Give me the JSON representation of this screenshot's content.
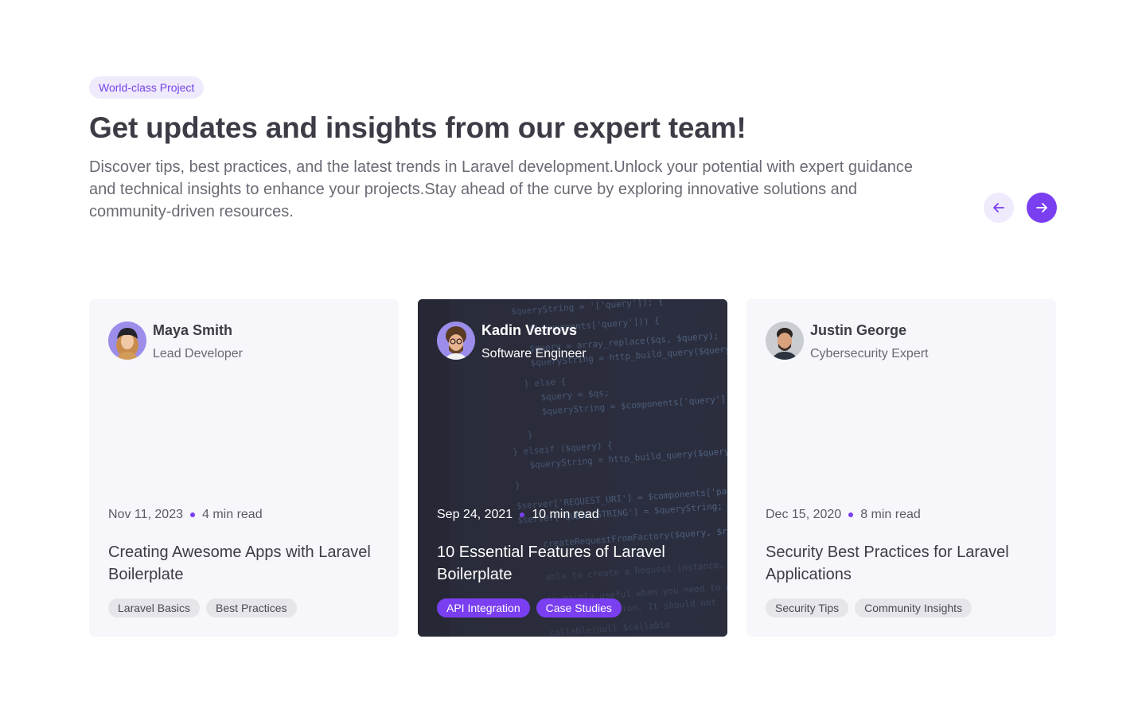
{
  "header": {
    "badge": "World-class Project",
    "title": "Get updates and insights from our expert team!",
    "description": "Discover tips, best practices, and the latest trends in Laravel development.Unlock your potential with expert guidance and technical insights to enhance your projects.Stay ahead of the curve by exploring innovative solutions and community-driven resources."
  },
  "navigation": {
    "prev_icon": "arrow-left-icon",
    "next_icon": "arrow-right-icon"
  },
  "colors": {
    "accent": "#7a3ff0",
    "badge_bg": "#efeafc",
    "card_bg": "#f6f6fb",
    "active_card_bg": "#2b2c3a"
  },
  "cards": [
    {
      "author_name": "Maya Smith",
      "author_role": "Lead Developer",
      "date": "Nov 11, 2023",
      "read_time": "4 min read",
      "title": "Creating Awesome Apps with Laravel Boilerplate",
      "tags": [
        "Laravel Basics",
        "Best Practices"
      ]
    },
    {
      "author_name": "Kadin Vetrovs",
      "author_role": "Software Engineer",
      "date": "Sep 24, 2021",
      "read_time": "10 min read",
      "title": "10 Essential Features of Laravel Boilerplate",
      "tags": [
        "API Integration",
        "Case Studies"
      ]
    },
    {
      "author_name": "Justin George",
      "author_role": "Cybersecurity Expert",
      "date": "Dec 15, 2020",
      "read_time": "8 min read",
      "title": "Security Best Practices for Laravel Applications",
      "tags": [
        "Security Tips",
        "Community Insights"
      ]
    }
  ]
}
